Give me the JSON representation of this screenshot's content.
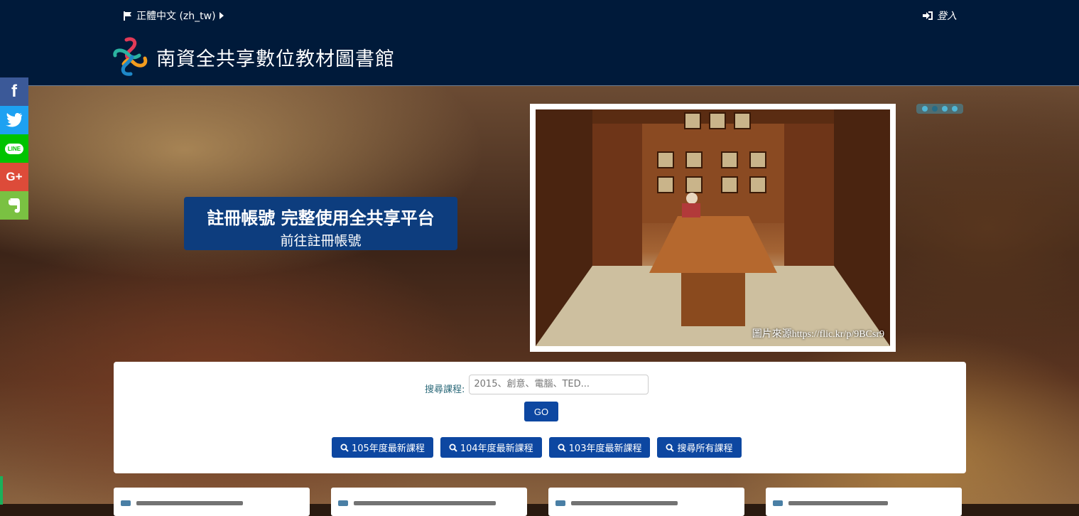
{
  "header": {
    "language": "正體中文 (zh_tw)",
    "login": "登入",
    "site_title": "南資全共享數位教材圖書館"
  },
  "social": [
    "facebook",
    "twitter",
    "line",
    "google-plus",
    "evernote"
  ],
  "banner": {
    "title": "註冊帳號 完整使用全共享平台",
    "link": "前往註冊帳號",
    "photo_caption": "圖片來源https://flic.kr/p/9BCsr9"
  },
  "search": {
    "label": "搜尋課程:",
    "placeholder": "2015、創意、電腦、TED...",
    "go": "GO"
  },
  "quick_links": [
    "105年度最新課程",
    "104年度最新課程",
    "103年度最新課程",
    "搜尋所有課程"
  ],
  "colors": {
    "header_bg": "#001a3a",
    "primary": "#0d47a1",
    "facebook": "#3b5998",
    "twitter": "#1da1f2",
    "line": "#00c300",
    "google_plus": "#dd4b39",
    "evernote": "#7ac142"
  }
}
